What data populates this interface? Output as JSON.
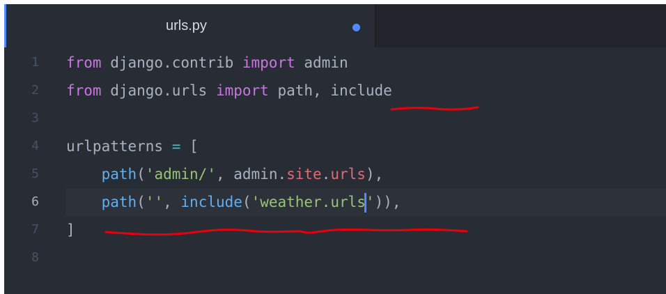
{
  "tab": {
    "title": "urls.py",
    "modified_indicator_color": "#528bff"
  },
  "editor": {
    "active_line": 6,
    "lines": [
      {
        "number": "1",
        "tokens": [
          {
            "t": "from",
            "c": "kw"
          },
          {
            "t": " django.contrib ",
            "c": ""
          },
          {
            "t": "import",
            "c": "kw"
          },
          {
            "t": " admin",
            "c": ""
          }
        ]
      },
      {
        "number": "2",
        "tokens": [
          {
            "t": "from",
            "c": "kw"
          },
          {
            "t": " django.urls ",
            "c": ""
          },
          {
            "t": "import",
            "c": "kw"
          },
          {
            "t": " path, include",
            "c": ""
          }
        ]
      },
      {
        "number": "3",
        "tokens": []
      },
      {
        "number": "4",
        "tokens": [
          {
            "t": "urlpatterns ",
            "c": ""
          },
          {
            "t": "=",
            "c": "op"
          },
          {
            "t": " [",
            "c": ""
          }
        ]
      },
      {
        "number": "5",
        "tokens": [
          {
            "t": "    ",
            "c": ""
          },
          {
            "t": "path",
            "c": "fn"
          },
          {
            "t": "(",
            "c": ""
          },
          {
            "t": "'admin/'",
            "c": "str"
          },
          {
            "t": ", admin.",
            "c": ""
          },
          {
            "t": "site",
            "c": "prop"
          },
          {
            "t": ".",
            "c": ""
          },
          {
            "t": "urls",
            "c": "prop"
          },
          {
            "t": "),",
            "c": ""
          }
        ]
      },
      {
        "number": "6",
        "tokens": [
          {
            "t": "    ",
            "c": ""
          },
          {
            "t": "path",
            "c": "fn"
          },
          {
            "t": "(",
            "c": ""
          },
          {
            "t": "''",
            "c": "str"
          },
          {
            "t": ", ",
            "c": ""
          },
          {
            "t": "include",
            "c": "fn"
          },
          {
            "t": "(",
            "c": ""
          },
          {
            "t": "'weather.urls",
            "c": "str"
          },
          {
            "t": "|",
            "c": "cursor"
          },
          {
            "t": "'",
            "c": "str"
          },
          {
            "t": ")),",
            "c": ""
          }
        ]
      },
      {
        "number": "7",
        "tokens": [
          {
            "t": "]",
            "c": ""
          }
        ]
      },
      {
        "number": "8",
        "tokens": []
      }
    ]
  },
  "annotations": {
    "color": "#e8000b"
  }
}
